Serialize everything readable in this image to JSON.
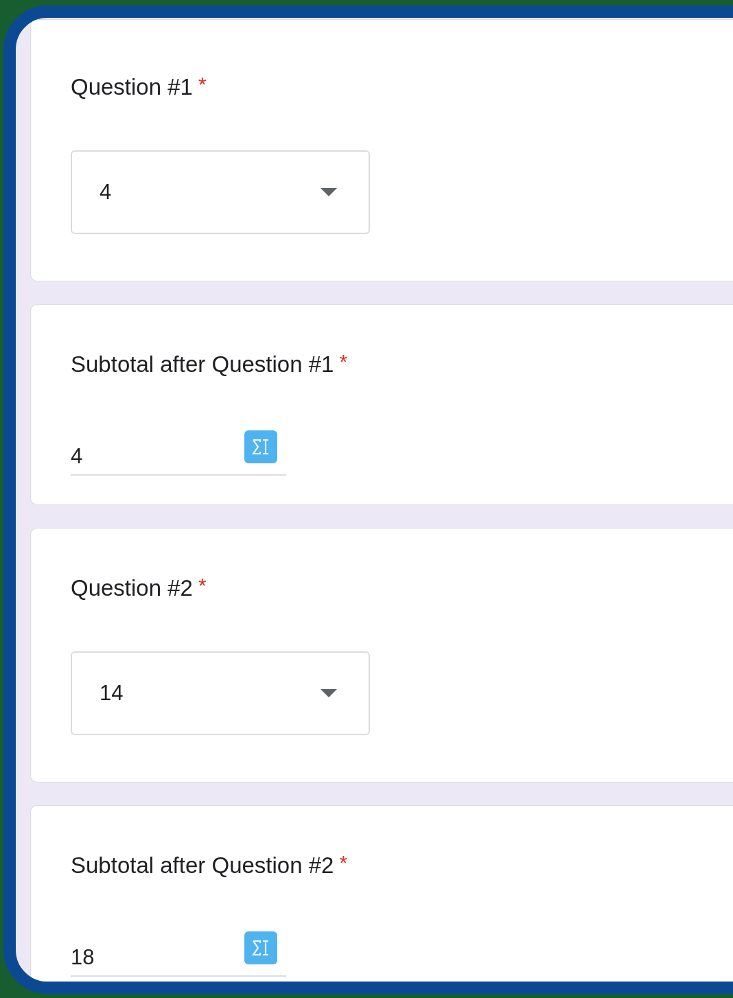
{
  "questions": [
    {
      "kind": "dropdown",
      "title": "Question #1",
      "required_mark": "*",
      "value": "4"
    },
    {
      "kind": "calculated",
      "title": "Subtotal after Question #1",
      "required_mark": "*",
      "value": "4"
    },
    {
      "kind": "dropdown",
      "title": "Question #2",
      "required_mark": "*",
      "value": "14"
    },
    {
      "kind": "calculated",
      "title": "Subtotal after Question #2",
      "required_mark": "*",
      "value": "18"
    }
  ]
}
